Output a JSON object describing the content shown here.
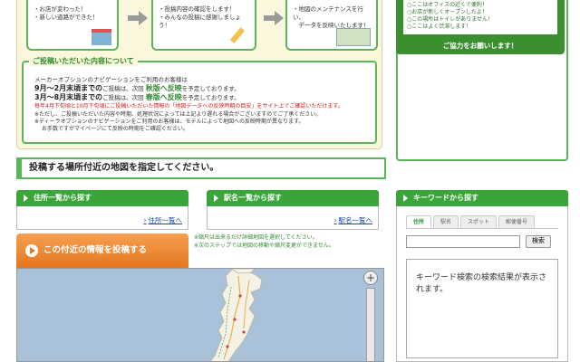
{
  "steps": [
    {
      "lines": [
        "・お店が変わった！",
        "・新しい道路ができた！"
      ]
    },
    {
      "lines": [
        "・投稿内容の確認をします！",
        "・みんなの投稿に感謝しましょう！"
      ]
    },
    {
      "lines": [
        "・地図のメンテナンスを行い、",
        "　データを反映いたします！"
      ]
    }
  ],
  "notice": {
    "title": "ご投稿いただいた内容について",
    "lead": "メーカーオプションのナビゲーションをご利用のお客様は",
    "row1_period": "9月〜2月末頃までの",
    "row1_mid": "ご投稿は、次回",
    "row1_reflect": "秋版へ反映",
    "row1_tail": "を予定しております。",
    "row2_period": "3月〜8月末頃までの",
    "row2_mid": "ご投稿は、次回",
    "row2_reflect": "春版へ反映",
    "row2_tail": "を予定しております。",
    "red_note": "毎年4月下旬頃と10月下旬頃にご投稿いただいた情報の「地図データへの反映時期の目安」をサイト上でご確認いただけます。",
    "note1": "※ただし、ご投稿いただいた内容や時期、処理状況によっては上記より遅れる場合がございますのでご了承ください。",
    "note2": "※ディーラオプションのナビゲーションをご利用のお客様は、モデルによって地図への反映時期が異なります。",
    "note3": "お手数ですがマイページにて反映の時期をご確認ください。"
  },
  "banner": {
    "line1": "○ここはオフィスの近くで便利！",
    "line2": "○お店が新しくオープンしたよ！",
    "line3": "○この場所はトイレがありません！",
    "line4": "○ここはよく渋滞します！",
    "cta": "ご協力をお願いします！"
  },
  "section_heading": "投稿する場所付近の地図を指定してください。",
  "address_panel": {
    "title": "住所一覧から探す",
    "link": "住所一覧へ"
  },
  "station_panel": {
    "title": "駅名一覧から探す",
    "link": "駅名一覧へ"
  },
  "keyword_panel": {
    "title": "キーワードから探す",
    "tabs": [
      "住所",
      "駅名",
      "スポット",
      "郵便番号"
    ],
    "input_value": "",
    "button_label": "検索",
    "results_text": "キーワード検索の検索結果が表示されます。"
  },
  "post_button_label": "この付近の情報を投稿する",
  "map_notes": [
    "※縮尺は出来るだけ詳細地図を選択してください。",
    "※次のステップでは地図の移動や縮尺変更ができません。"
  ],
  "zoom_plus_label": "+",
  "colors": {
    "green": "#3aa63a",
    "orange": "#e5761f",
    "sea": "#a9c1d9",
    "land": "#f4f2e6"
  }
}
